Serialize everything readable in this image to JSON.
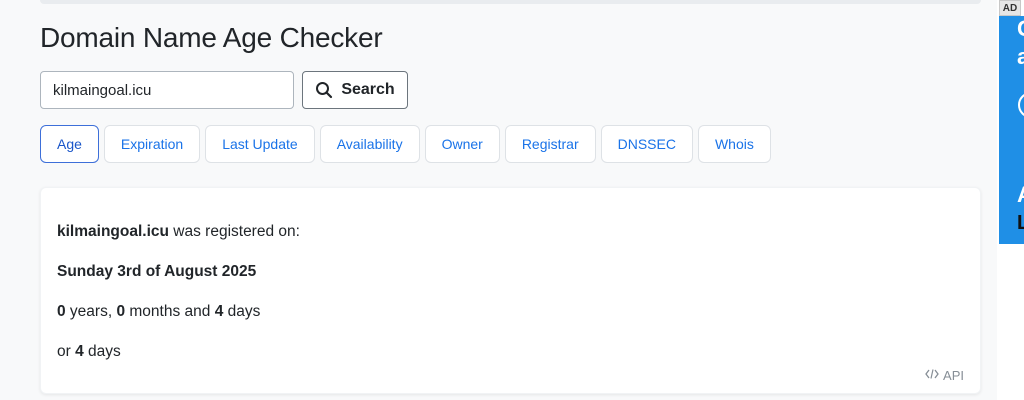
{
  "header": {
    "title": "Domain Name Age Checker"
  },
  "search": {
    "value": "kilmaingoal.icu",
    "button_label": "Search"
  },
  "tabs": [
    {
      "label": "Age",
      "active": true
    },
    {
      "label": "Expiration",
      "active": false
    },
    {
      "label": "Last Update",
      "active": false
    },
    {
      "label": "Availability",
      "active": false
    },
    {
      "label": "Owner",
      "active": false
    },
    {
      "label": "Registrar",
      "active": false
    },
    {
      "label": "DNSSEC",
      "active": false
    },
    {
      "label": "Whois",
      "active": false
    }
  ],
  "result": {
    "domain": "kilmaingoal.icu",
    "registered_text": " was registered on:",
    "date": "Sunday 3rd of August 2025",
    "years": "0",
    "years_text": " years, ",
    "months": "0",
    "months_text": " months and ",
    "days": "4",
    "days_text": " days",
    "or_text": "or ",
    "total_days": "4",
    "total_days_text": " days"
  },
  "api": {
    "label": "API",
    "icon": "code-icon"
  },
  "ad": {
    "badge": "AD",
    "glyphs": [
      "C",
      "a",
      "A",
      "L"
    ],
    "color": "#1f8fe6"
  },
  "colors": {
    "accent": "#1a73e8",
    "active_border": "#3d6fd9",
    "background": "#f8f9fa"
  }
}
